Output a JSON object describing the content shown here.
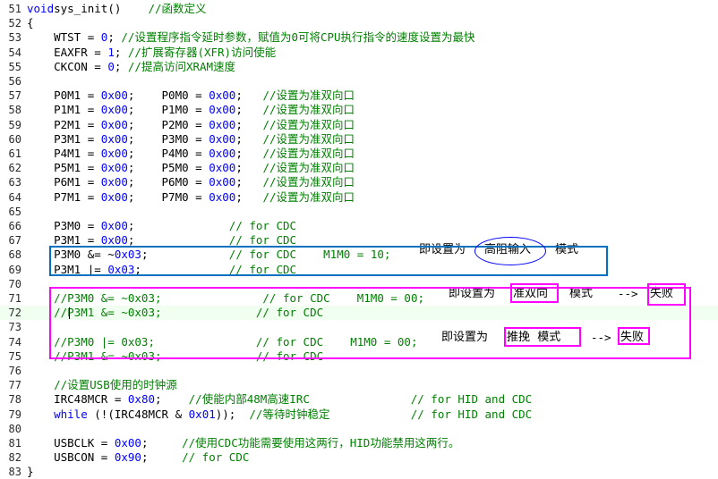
{
  "editor": {
    "lines": [
      {
        "n": "51",
        "segs": [
          [
            "k",
            "void"
          ],
          [
            "",
            "sys_init()"
          ],
          [
            "",
            "    "
          ],
          [
            "c",
            "//函数定义"
          ]
        ]
      },
      {
        "n": "52",
        "segs": [
          [
            "",
            "{"
          ]
        ]
      },
      {
        "n": "53",
        "segs": [
          [
            "",
            "    WTST = "
          ],
          [
            "n",
            "0"
          ],
          [
            "",
            "; "
          ],
          [
            "c",
            "//设置程序指令延时参数，赋值为0可将CPU执行指令的速度设置为最快"
          ]
        ]
      },
      {
        "n": "54",
        "segs": [
          [
            "",
            "    EAXFR = "
          ],
          [
            "n",
            "1"
          ],
          [
            "",
            "; "
          ],
          [
            "c",
            "//扩展寄存器(XFR)访问使能"
          ]
        ]
      },
      {
        "n": "55",
        "segs": [
          [
            "",
            "    CKCON = "
          ],
          [
            "n",
            "0"
          ],
          [
            "",
            "; "
          ],
          [
            "c",
            "//提高访问XRAM速度"
          ]
        ]
      },
      {
        "n": "56",
        "segs": []
      },
      {
        "n": "57",
        "segs": [
          [
            "",
            "    P0M1 = "
          ],
          [
            "n",
            "0x00"
          ],
          [
            "",
            ";    P0M0 = "
          ],
          [
            "n",
            "0x00"
          ],
          [
            "",
            ";   "
          ],
          [
            "c",
            "//设置为准双向口"
          ]
        ]
      },
      {
        "n": "58",
        "segs": [
          [
            "",
            "    P1M1 = "
          ],
          [
            "n",
            "0x00"
          ],
          [
            "",
            ";    P1M0 = "
          ],
          [
            "n",
            "0x00"
          ],
          [
            "",
            ";   "
          ],
          [
            "c",
            "//设置为准双向口"
          ]
        ]
      },
      {
        "n": "59",
        "segs": [
          [
            "",
            "    P2M1 = "
          ],
          [
            "n",
            "0x00"
          ],
          [
            "",
            ";    P2M0 = "
          ],
          [
            "n",
            "0x00"
          ],
          [
            "",
            ";   "
          ],
          [
            "c",
            "//设置为准双向口"
          ]
        ]
      },
      {
        "n": "60",
        "segs": [
          [
            "",
            "    P3M1 = "
          ],
          [
            "n",
            "0x00"
          ],
          [
            "",
            ";    P3M0 = "
          ],
          [
            "n",
            "0x00"
          ],
          [
            "",
            ";   "
          ],
          [
            "c",
            "//设置为准双向口"
          ]
        ]
      },
      {
        "n": "61",
        "segs": [
          [
            "",
            "    P4M1 = "
          ],
          [
            "n",
            "0x00"
          ],
          [
            "",
            ";    P4M0 = "
          ],
          [
            "n",
            "0x00"
          ],
          [
            "",
            ";   "
          ],
          [
            "c",
            "//设置为准双向口"
          ]
        ]
      },
      {
        "n": "62",
        "segs": [
          [
            "",
            "    P5M1 = "
          ],
          [
            "n",
            "0x00"
          ],
          [
            "",
            ";    P5M0 = "
          ],
          [
            "n",
            "0x00"
          ],
          [
            "",
            ";   "
          ],
          [
            "c",
            "//设置为准双向口"
          ]
        ]
      },
      {
        "n": "63",
        "segs": [
          [
            "",
            "    P6M1 = "
          ],
          [
            "n",
            "0x00"
          ],
          [
            "",
            ";    P6M0 = "
          ],
          [
            "n",
            "0x00"
          ],
          [
            "",
            ";   "
          ],
          [
            "c",
            "//设置为准双向口"
          ]
        ]
      },
      {
        "n": "64",
        "segs": [
          [
            "",
            "    P7M1 = "
          ],
          [
            "n",
            "0x00"
          ],
          [
            "",
            ";    P7M0 = "
          ],
          [
            "n",
            "0x00"
          ],
          [
            "",
            ";   "
          ],
          [
            "c",
            "//设置为准双向口"
          ]
        ]
      },
      {
        "n": "65",
        "segs": []
      },
      {
        "n": "66",
        "segs": [
          [
            "",
            "    P3M0 = "
          ],
          [
            "n",
            "0x00"
          ],
          [
            "",
            ";              "
          ],
          [
            "c",
            "// for CDC"
          ]
        ]
      },
      {
        "n": "67",
        "segs": [
          [
            "",
            "    P3M1 = "
          ],
          [
            "n",
            "0x00"
          ],
          [
            "",
            ";              "
          ],
          [
            "c",
            "// for CDC"
          ]
        ]
      },
      {
        "n": "68",
        "segs": [
          [
            "",
            "    P3M0 &= ~"
          ],
          [
            "n",
            "0x03"
          ],
          [
            "",
            ";            "
          ],
          [
            "c",
            "// for CDC    M1M0 = 10;"
          ]
        ]
      },
      {
        "n": "69",
        "segs": [
          [
            "",
            "    P3M1 |= "
          ],
          [
            "n",
            "0x03"
          ],
          [
            "",
            ";             "
          ],
          [
            "c",
            "// for CDC"
          ]
        ]
      },
      {
        "n": "70",
        "segs": []
      },
      {
        "n": "71",
        "segs": [
          [
            "c",
            "    //P3M0 &= ~0x03;               // for CDC    M1M0 = 00;"
          ]
        ]
      },
      {
        "n": "72",
        "segs": [
          [
            "c",
            "    //P3M1 &= ~0x03;              // for CDC"
          ]
        ]
      },
      {
        "n": "73",
        "segs": []
      },
      {
        "n": "74",
        "segs": [
          [
            "c",
            "    //P3M0 |= 0x03;               // for CDC    M1M0 = 00;"
          ]
        ]
      },
      {
        "n": "75",
        "segs": [
          [
            "c",
            "    //P3M1 &= ~0x03;              // for CDC"
          ]
        ]
      },
      {
        "n": "76",
        "segs": []
      },
      {
        "n": "77",
        "segs": [
          [
            "c",
            "    //设置USB使用的时钟源"
          ]
        ]
      },
      {
        "n": "78",
        "segs": [
          [
            "",
            "    IRC48MCR = "
          ],
          [
            "n",
            "0x80"
          ],
          [
            "",
            ";    "
          ],
          [
            "c",
            "//使能内部48M高速IRC               // for HID and CDC"
          ]
        ]
      },
      {
        "n": "79",
        "segs": [
          [
            "",
            "    "
          ],
          [
            "k",
            "while"
          ],
          [
            "",
            " (!(IRC48MCR & "
          ],
          [
            "n",
            "0x01"
          ],
          [
            "",
            "));  "
          ],
          [
            "c",
            "//等待时钟稳定            // for HID and CDC"
          ]
        ]
      },
      {
        "n": "80",
        "segs": []
      },
      {
        "n": "81",
        "segs": [
          [
            "",
            "    USBCLK = "
          ],
          [
            "n",
            "0x00"
          ],
          [
            "",
            ";     "
          ],
          [
            "c",
            "//使用CDC功能需要使用这两行，HID功能禁用这两行。"
          ]
        ]
      },
      {
        "n": "82",
        "segs": [
          [
            "",
            "    USBCON = "
          ],
          [
            "n",
            "0x90"
          ],
          [
            "",
            ";     "
          ],
          [
            "c",
            "// for CDC"
          ]
        ]
      },
      {
        "n": "83",
        "segs": [
          [
            "",
            "}"
          ]
        ]
      }
    ]
  },
  "annotations": {
    "line68_prefix": "即设置为",
    "line68_mode": "高阻输入",
    "line68_suffix": "模式",
    "line71_prefix": "即设置为",
    "line71_mode": "准双向",
    "line71_suffix": "模式",
    "line71_arrow": "-->",
    "line71_result": "失败",
    "line74_prefix": "即设置为",
    "line74_mode": "推挽  模式",
    "line74_arrow": "-->",
    "line74_result": "失败"
  },
  "colors": {
    "keyword": "#0000ff",
    "number": "#0000ff",
    "comment": "#008000",
    "blue_box": "#0070c0",
    "magenta_box": "#ff00ff",
    "current_line": "#f0fff0"
  }
}
